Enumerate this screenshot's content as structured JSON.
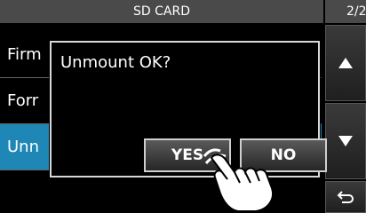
{
  "header": {
    "title": "SD CARD",
    "page": "2/2"
  },
  "menu": {
    "items": [
      {
        "label": "Firm"
      },
      {
        "label": "Forr"
      },
      {
        "label": "Unn",
        "selected": true
      }
    ]
  },
  "dialog": {
    "message": "Unmount OK?",
    "yes_label": "YES",
    "no_label": "NO"
  },
  "side_buttons": {
    "up_icon": "triangle-up-icon",
    "down_icon": "triangle-down-icon",
    "back_icon": "return-arrow-icon"
  },
  "colors": {
    "selected_row": "#1f87b6",
    "header_bg": "#4a4a4a"
  }
}
